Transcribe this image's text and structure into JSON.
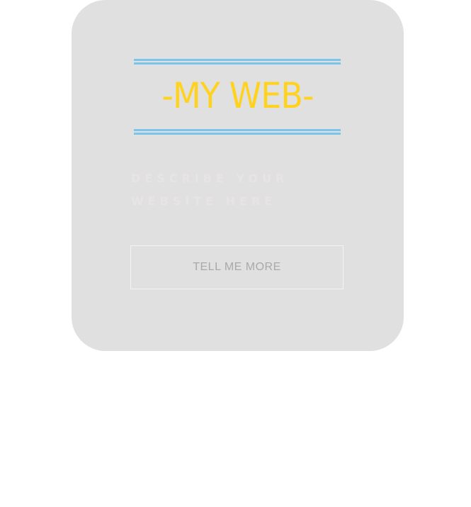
{
  "hero": {
    "title": "-MY WEB-",
    "tagline": "DESCRIBE YOUR WEBSITE HERE",
    "button_label": "TELL ME MORE"
  },
  "colors": {
    "card_background": "#e0e0e0",
    "title": "#ffd21f",
    "rule": "#7cc4ea",
    "button_text": "#a9a9a9"
  }
}
